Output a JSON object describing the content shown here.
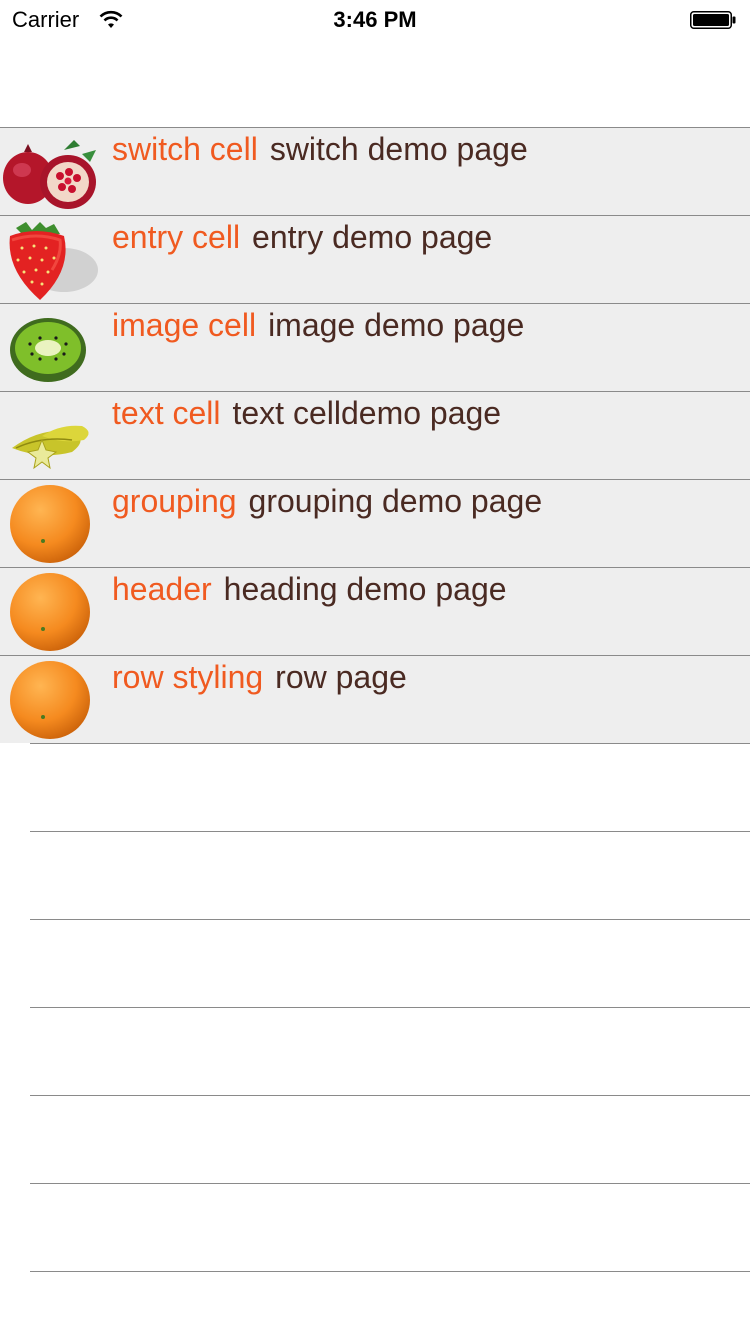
{
  "status_bar": {
    "carrier": "Carrier",
    "time": "3:46 PM",
    "wifi_icon": "wifi-icon",
    "battery_icon": "battery-full-icon"
  },
  "list": {
    "rows": [
      {
        "title": "switch cell",
        "detail": "switch demo page",
        "icon": "pomegranate-icon"
      },
      {
        "title": "entry cell",
        "detail": "entry demo page",
        "icon": "strawberry-icon"
      },
      {
        "title": "image cell",
        "detail": "image demo page",
        "icon": "kiwi-icon"
      },
      {
        "title": "text cell",
        "detail": "text celldemo page",
        "icon": "starfruit-icon"
      },
      {
        "title": "grouping",
        "detail": "grouping demo page",
        "icon": "orange-icon"
      },
      {
        "title": "header",
        "detail": "heading demo page",
        "icon": "orange-icon"
      },
      {
        "title": "row styling",
        "detail": "row page",
        "icon": "orange-icon"
      }
    ]
  },
  "colors": {
    "title": "#f05a20",
    "detail": "#4a2a22",
    "row_background": "#eeeeee",
    "separator": "#8a8a8a"
  }
}
